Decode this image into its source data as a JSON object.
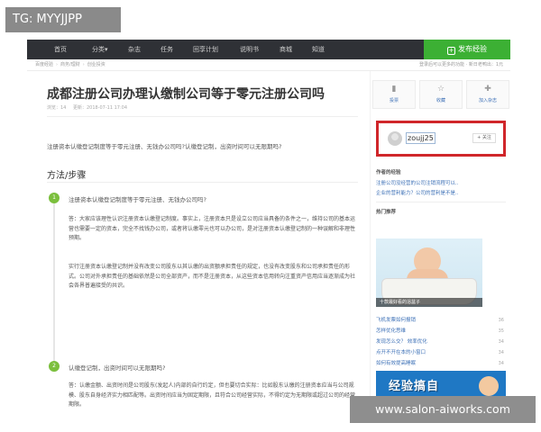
{
  "watermarks": {
    "top_left": "TG: MYYJJPP",
    "bottom_right": "www.salon-aiworks.com"
  },
  "nav": {
    "items": [
      "首页",
      "分类▾",
      "杂志",
      "任务",
      "回享计划",
      "说明书",
      "商城",
      "知道"
    ],
    "publish_label": "发布经验"
  },
  "breadcrumb": {
    "items": [
      "百度经验",
      "商务/理财",
      "创业投资"
    ],
    "right_info": "登录后可以更多的功能 · 新日老鸭出：1元"
  },
  "article": {
    "title": "成都注册公司办理认缴制公司等于零元注册公司吗",
    "meta": [
      "浏览：14",
      "更新：2018-07-11 17:04"
    ],
    "intro": "注册资本认缴登记制度等于零元注册、无钱办公司吗?认缴登记制，出资时间可以无限期吗?",
    "method_heading": "方法/步骤",
    "steps": [
      {
        "num": "1",
        "title": "注册资本认缴登记制度等于零元注册、无钱办公司吗?",
        "paras": [
          "答：大家应该理性认识注册资本认缴登记制度。事实上，注册资本只是设立公司应当具备的条件之一，维持公司的基本运营也需要一定的资本，完全不找钱办公司，或者将认缴零元也可以办公司，是对注册资本认缴登记制的一种误解和非理性预期。",
          "实行注册资本认缴登记制并没有改变公司股东以其认缴的出资额承担责任的规定，也没有改变股东和公司承担责任的形式。公司对外承担责任的基础依然是公司全部资产，而不是注册资本，从这些资本信用转向注重资产信用应当逐渐成为社会各界普遍接受的共识。"
        ]
      },
      {
        "num": "2",
        "title": "认缴登记制，出资时间可以无限期吗?",
        "paras": [
          "答：认缴金额、出资时间是公司股东(发起人)内部的自行约定，但也要切合实际：比如股东认缴的注册资本应当与公司规模、股东自身经济实力相匹配等。出资时间应当为固定期限，且符合公司经营实际，不得约定为无期限或超过公司的经营期限。"
        ]
      }
    ]
  },
  "sidebar": {
    "actions": [
      {
        "icon": "chart-icon",
        "glyph": "▮",
        "label": "投票"
      },
      {
        "icon": "star-icon",
        "glyph": "☆",
        "label": "收藏"
      },
      {
        "icon": "magazine-icon",
        "glyph": "✚",
        "label": "加入杂志"
      }
    ],
    "user": {
      "name": "zoujj25",
      "follow_label": "+ 关注"
    },
    "author_section": {
      "title": "作者的经验",
      "links": [
        "注册公司没经营的公司注销流程可以..",
        "企业的营利能力？公司的营利是不是.."
      ]
    },
    "recommend": {
      "title": "热门推荐",
      "image_caption": "十款最好看的浴盆子",
      "items": [
        {
          "text": "飞机发票如何报销",
          "count": "36"
        },
        {
          "text": "怎样优化思维",
          "count": "35"
        },
        {
          "text": "发现怎么交？ 效率优化",
          "count": "34"
        },
        {
          "text": "点开不开在本的小窗口",
          "count": "34"
        },
        {
          "text": "如何有效提高睡眠",
          "count": "34"
        }
      ]
    },
    "banner_text": "经验搞自"
  }
}
